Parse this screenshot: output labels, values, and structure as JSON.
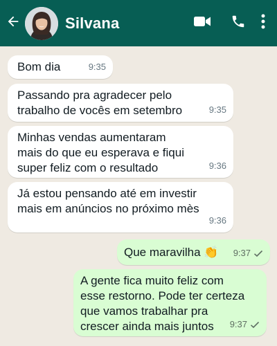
{
  "header": {
    "contact_name": "Silvana",
    "back_icon": "arrow-left-icon",
    "video_icon": "video-call-icon",
    "call_icon": "phone-icon",
    "menu_icon": "more-vert-icon",
    "bg_color": "#075e54"
  },
  "messages": [
    {
      "dir": "in",
      "text": "Bom dia",
      "time": "9:35"
    },
    {
      "dir": "in",
      "text": "Passando pra agradecer pelo\ntrabalho de vocês em setembro",
      "time": "9:35"
    },
    {
      "dir": "in",
      "text": "Minhas vendas aumentaram\nmais do que eu esperava e fiqui\nsuper feliz com o resultado",
      "time": "9:36"
    },
    {
      "dir": "in",
      "text": "Já estou pensando até em investir\nmais em anúncios no próximo mès",
      "time": "9:36"
    },
    {
      "dir": "out",
      "text": "Que maravilha 👏",
      "time": "9:37",
      "status": "sent"
    },
    {
      "dir": "out",
      "text": "A gente fica muito feliz com\nesse restorno. Pode ter certeza\nque vamos trabalhar pra\ncrescer ainda mais juntos",
      "time": "9:37",
      "status": "sent"
    }
  ],
  "colors": {
    "chat_bg": "#efeae2",
    "incoming_bubble": "#ffffff",
    "outgoing_bubble": "#d9fdd3"
  }
}
